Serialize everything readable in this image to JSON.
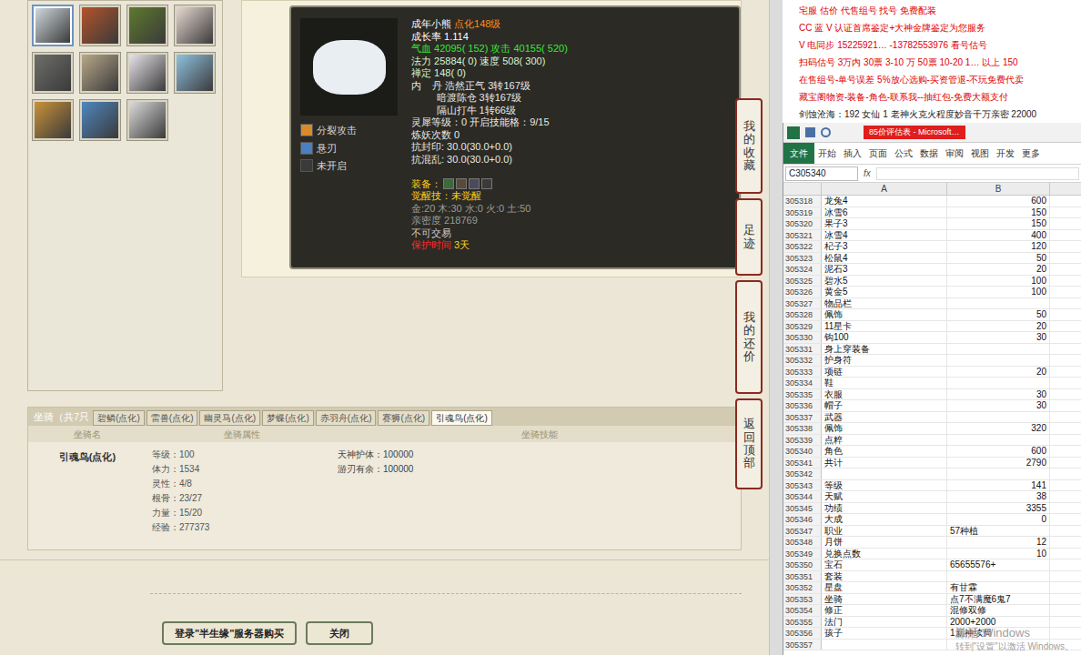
{
  "pet_list": {
    "avatars": [
      {
        "color": "#cfd8de",
        "selected": true
      },
      {
        "color": "#b4532a",
        "selected": false
      },
      {
        "color": "#5d7a2e",
        "selected": false
      },
      {
        "color": "#e6d8d2",
        "selected": false
      },
      {
        "color": "#6e6e6a",
        "selected": false
      },
      {
        "color": "#b8a88a",
        "selected": false
      },
      {
        "color": "#e8e4ea",
        "selected": false
      },
      {
        "color": "#8fc2e0",
        "selected": false
      },
      {
        "color": "#c9923a",
        "selected": false
      },
      {
        "color": "#4f86c0",
        "selected": false
      },
      {
        "color": "#dcdcdc",
        "selected": false
      }
    ]
  },
  "pet_card": {
    "image_color": "#e9eef2",
    "skills": [
      {
        "name": "分裂攻击",
        "color": "#d98a2b"
      },
      {
        "name": "悬刃",
        "color": "#4a7fc1"
      },
      {
        "name": "未开启",
        "color": "#3a3a3a"
      }
    ],
    "lines": [
      {
        "segments": [
          {
            "text": "成年小熊 ",
            "color": "#ffffff"
          },
          {
            "text": "点化148级",
            "color": "#ff8c1a"
          }
        ]
      },
      {
        "segments": [
          {
            "text": "成长率 1.114",
            "color": "#ffffff"
          }
        ]
      },
      {
        "segments": [
          {
            "text": "气血 42095( 152) 攻击 40155( 520)",
            "color": "#39e639"
          }
        ]
      },
      {
        "segments": [
          {
            "text": "法力 25884( 0) 速度 508( 300)",
            "color": "#d6f5d6"
          }
        ]
      },
      {
        "segments": [
          {
            "text": "禅定 148( 0)",
            "color": "#d6f5d6"
          }
        ]
      },
      {
        "segments": [
          {
            "text": "内    丹 浩然正气 3转167级",
            "color": "#e8e8e8"
          }
        ]
      },
      {
        "segments": [
          {
            "text": "         暗渡陈仓 3转167级",
            "color": "#e8e8e8"
          }
        ]
      },
      {
        "segments": [
          {
            "text": "         隔山打牛 1转66级",
            "color": "#e8e8e8"
          }
        ]
      },
      {
        "segments": [
          {
            "text": "灵犀等级：0 开启技能格：9/15",
            "color": "#e8e8e8"
          }
        ]
      },
      {
        "segments": [
          {
            "text": "炼妖次数 0",
            "color": "#e8e8e8"
          }
        ]
      },
      {
        "segments": [
          {
            "text": "抗封印: 30.0(30.0+0.0)",
            "color": "#e8e8e8"
          }
        ]
      },
      {
        "segments": [
          {
            "text": "抗混乱: 30.0(30.0+0.0)",
            "color": "#e8e8e8"
          }
        ]
      },
      {
        "segments": [
          {
            "text": " ",
            "color": "#e8e8e8"
          }
        ]
      },
      {
        "segments": [
          {
            "text": "装备：",
            "color": "#ffd21f"
          }
        ]
      },
      {
        "segments": [
          {
            "text": "觉醒技：未觉醒",
            "color": "#ffd21f"
          }
        ]
      },
      {
        "segments": [
          {
            "text": "金:20 木:30 水:0 火:0 土:50",
            "color": "#9a9a9a"
          }
        ]
      },
      {
        "segments": [
          {
            "text": "亲密度 218769",
            "color": "#9a9a9a"
          }
        ]
      },
      {
        "segments": [
          {
            "text": "不可交易",
            "color": "#cfcfcf"
          }
        ]
      },
      {
        "segments": [
          {
            "text": "保护时间 ",
            "color": "#ff2a2a"
          },
          {
            "text": "3天",
            "color": "#ffd21f"
          }
        ]
      }
    ]
  },
  "side_tabs": [
    "我的收藏",
    "足迹",
    "我的还价",
    "返回顶部"
  ],
  "mounts": {
    "header": "坐骑（共7只",
    "tabs": [
      {
        "label": "碧鳞(点化)",
        "selected": false
      },
      {
        "label": "雷兽(点化)",
        "selected": false
      },
      {
        "label": "幽灵马(点化)",
        "selected": false
      },
      {
        "label": "梦蝶(点化)",
        "selected": false
      },
      {
        "label": "赤羽舟(点化)",
        "selected": false
      },
      {
        "label": "赛狮(点化)",
        "selected": false
      },
      {
        "label": "引魂鸟(点化)",
        "selected": true
      }
    ],
    "columns": [
      "坐骑名",
      "坐骑属性",
      "坐骑技能"
    ],
    "row": {
      "name": "引魂鸟(点化)",
      "attributes": [
        "等级：100",
        "体力：1534",
        "灵性：4/8",
        "根骨：23/27",
        "力量：15/20",
        "经验：277373"
      ],
      "skills": [
        "天神护体：100000",
        "游刃有余：100000"
      ]
    }
  },
  "buttons": [
    "登录\"半生缘\"服务器购买",
    "关闭"
  ],
  "ads": {
    "lines": [
      {
        "text": "宅服 估价 代售组号 找号 免费配装",
        "color": "#e00000"
      },
      {
        "text": "CC 蓝 V 认证首席鉴定+大神金牌鉴定为您服务",
        "color": "#e00000"
      },
      {
        "text": "V 电同步 15225921… -13782553976 看号估号",
        "color": "#e00000"
      },
      {
        "text": "扫码估号 3万内 30票 3-10 万 50票 10-20 1… 以上 150",
        "color": "#e00000"
      },
      {
        "text": "在售组号-单号误差 5%放心选购-买资管退-不玩免费代卖",
        "color": "#e00000"
      },
      {
        "text": "藏宝阁物资-装备-角色-联系我--抽红包-免费大额支付",
        "color": "#e00000"
      },
      {
        "text": "剑蚀沧海：192 女仙 1 老神火克火程度妙音千万亲密 22000",
        "color": "#222222"
      }
    ]
  },
  "excel": {
    "title": "85价评估表 - Microsoft…",
    "ribbon_tabs": [
      {
        "label": "文件",
        "selected": true
      },
      {
        "label": "开始",
        "selected": false
      },
      {
        "label": "插入",
        "selected": false
      },
      {
        "label": "页面",
        "selected": false
      },
      {
        "label": "公式",
        "selected": false
      },
      {
        "label": "数据",
        "selected": false
      },
      {
        "label": "审阅",
        "selected": false
      },
      {
        "label": "视图",
        "selected": false
      },
      {
        "label": "开发",
        "selected": false
      },
      {
        "label": "更多",
        "selected": false
      }
    ],
    "name_box": "C305340",
    "fx": "fx",
    "columns": [
      "A",
      "B"
    ],
    "rows": [
      {
        "num": "305318",
        "a": "龙兔4",
        "b": "600"
      },
      {
        "num": "305319",
        "a": "冰雪6",
        "b": "150"
      },
      {
        "num": "305320",
        "a": "果子3",
        "b": "150"
      },
      {
        "num": "305321",
        "a": "冰雪4",
        "b": "400"
      },
      {
        "num": "305322",
        "a": "杞子3",
        "b": "120"
      },
      {
        "num": "305323",
        "a": "松鼠4",
        "b": "50"
      },
      {
        "num": "305324",
        "a": "泥石3",
        "b": "20"
      },
      {
        "num": "305325",
        "a": "碧水5",
        "b": "100"
      },
      {
        "num": "305326",
        "a": "黄金5",
        "b": "100"
      },
      {
        "num": "305327",
        "a": "物品栏",
        "b": ""
      },
      {
        "num": "305328",
        "a": "佩饰",
        "b": "50"
      },
      {
        "num": "305329",
        "a": "11星卡",
        "b": "20"
      },
      {
        "num": "305330",
        "a": "钩100",
        "b": "30"
      },
      {
        "num": "305331",
        "a": "身上穿装备",
        "b": ""
      },
      {
        "num": "305332",
        "a": "护身符",
        "b": ""
      },
      {
        "num": "305333",
        "a": "项链",
        "b": "20"
      },
      {
        "num": "305334",
        "a": "鞋",
        "b": ""
      },
      {
        "num": "305335",
        "a": "衣服",
        "b": "30"
      },
      {
        "num": "305336",
        "a": "帽子",
        "b": "30"
      },
      {
        "num": "305337",
        "a": "武器",
        "b": ""
      },
      {
        "num": "305338",
        "a": "佩饰",
        "b": "320"
      },
      {
        "num": "305339",
        "a": "点粹",
        "b": ""
      },
      {
        "num": "305340",
        "a": "角色",
        "b": "600"
      },
      {
        "num": "305341",
        "a": "共计",
        "b": "2790"
      },
      {
        "num": "305342",
        "a": "",
        "b": ""
      },
      {
        "num": "305343",
        "a": "等级",
        "b": "141"
      },
      {
        "num": "305344",
        "a": "天赋",
        "b": "38"
      },
      {
        "num": "305345",
        "a": "功绩",
        "b": "3355"
      },
      {
        "num": "305346",
        "a": "大成",
        "b": "0"
      },
      {
        "num": "305347",
        "a": "职业",
        "b": "57种植"
      },
      {
        "num": "305348",
        "a": "月饼",
        "b": "12"
      },
      {
        "num": "305349",
        "a": "兑换点数",
        "b": "10"
      },
      {
        "num": "305350",
        "a": "宝石",
        "b": "65655576+"
      },
      {
        "num": "305351",
        "a": "套装",
        "b": ""
      },
      {
        "num": "305352",
        "a": "星盘",
        "b": "有甘霖"
      },
      {
        "num": "305353",
        "a": "坐骑",
        "b": "点7不满魔6鬼7"
      },
      {
        "num": "305354",
        "a": "修正",
        "b": "混修双修"
      },
      {
        "num": "305355",
        "a": "法门",
        "b": "2000+2000"
      },
      {
        "num": "305356",
        "a": "孩子",
        "b": "1新神续局"
      },
      {
        "num": "305357",
        "a": "",
        "b": ""
      }
    ]
  },
  "watermark": [
    "激活 Windows",
    "转到\"设置\"以激活 Windows。"
  ]
}
